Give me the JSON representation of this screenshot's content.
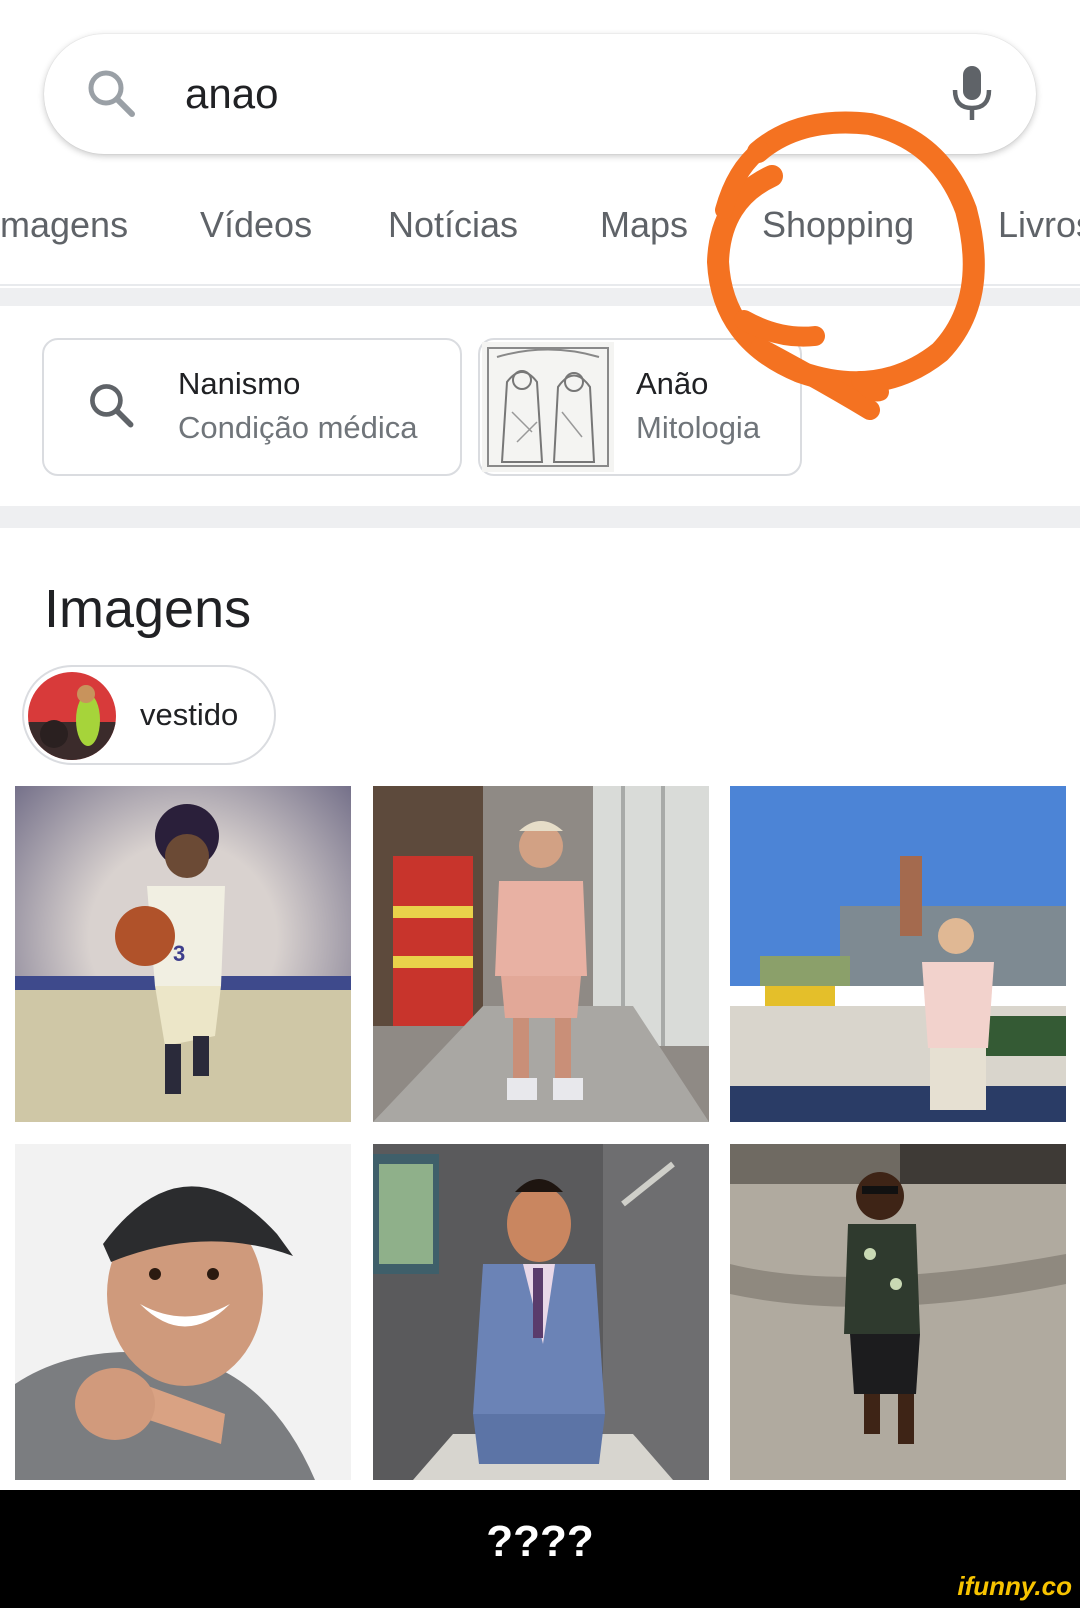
{
  "search": {
    "query": "anao"
  },
  "tabs": [
    {
      "label": "Imagens"
    },
    {
      "label": "Vídeos"
    },
    {
      "label": "Notícias"
    },
    {
      "label": "Maps"
    },
    {
      "label": "Shopping"
    },
    {
      "label": "Livros"
    }
  ],
  "knowledge_chips": [
    {
      "title": "Nanismo",
      "subtitle": "Condição médica"
    },
    {
      "title": "Anão",
      "subtitle": "Mitologia"
    }
  ],
  "images_section": {
    "title": "Imagens",
    "refine_chip": "vestido",
    "tiles": [
      {
        "subject": "basketball player in white jersey number 3"
      },
      {
        "subject": "man in pink outfit in grocery store aisle"
      },
      {
        "subject": "man in pink shirt outdoors in plaza"
      },
      {
        "subject": "smiling man in black cap pointing"
      },
      {
        "subject": "man in blue suit in studio"
      },
      {
        "subject": "man in patterned tank top on pavement"
      }
    ]
  },
  "annotation": {
    "color": "#f47221",
    "circled_item": "Shopping"
  },
  "meme": {
    "caption": "????",
    "watermark": "ifunny.co"
  },
  "colors": {
    "tab_text": "#5f6368",
    "primary_text": "#202124",
    "secondary_text": "#70757a",
    "chip_border": "#dadce0"
  }
}
